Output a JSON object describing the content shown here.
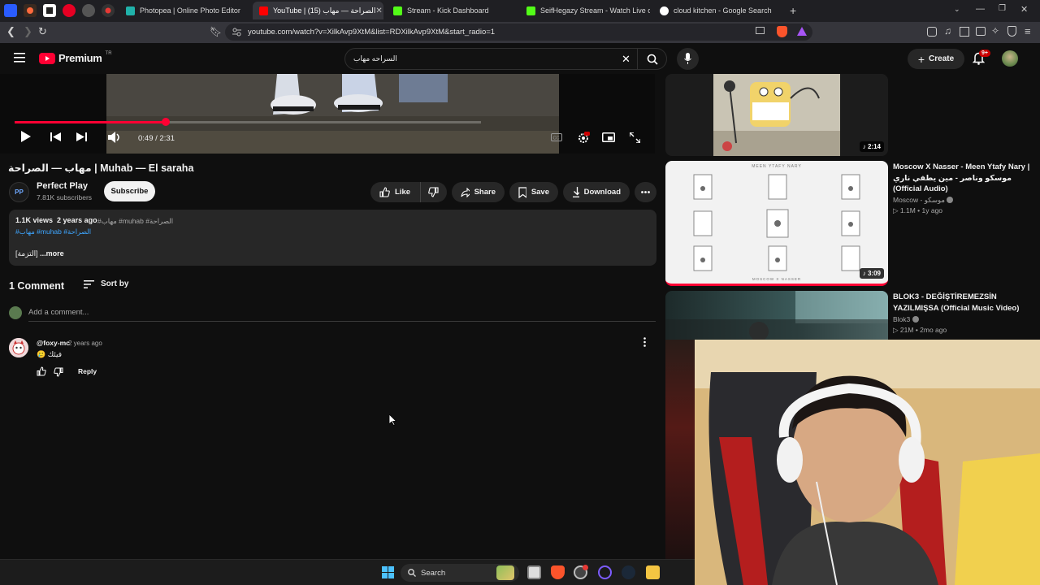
{
  "browser": {
    "tabs": [
      {
        "title": "Photopea | Online Photo Editor",
        "color": "#20b2aa"
      },
      {
        "title": "YouTube | الصراحة — مهاب (15)",
        "color": "#ff0000",
        "active": true
      },
      {
        "title": "Stream - Kick Dashboard",
        "color": "#53fc18"
      },
      {
        "title": "SeifHegazy Stream - Watch Live on K",
        "color": "#53fc18"
      },
      {
        "title": "cloud kitchen - Google Search",
        "color": "#ffffff"
      }
    ],
    "new_tab": "+",
    "url": "youtube.com/watch?v=XilkAvp9XtM&list=RDXilkAvp9XtM&start_radio=1"
  },
  "youtube": {
    "logo": "Premium",
    "logo_region": "TR",
    "search_query": "السراحه مهاب",
    "create_label": "Create",
    "notif_badge": "9+"
  },
  "player": {
    "time": "0:49 / 2:31",
    "progress_fraction": 0.324
  },
  "video": {
    "title": "مهاب — الصراحة | Muhab — El saraha",
    "channel": "Perfect Play",
    "channel_avatar": "PP",
    "subscribers": "7.81K subscribers",
    "subscribe_label": "Subscribe",
    "like_label": "Like",
    "share_label": "Share",
    "save_label": "Save",
    "download_label": "Download"
  },
  "description": {
    "views": "1.1K views",
    "age": "2 years ago",
    "tags_line1": "#مهاب #muhab #الصراحة",
    "tags_line2": "#مهاب #muhab #الصراحة",
    "snippet": "[التزمة]",
    "more_label": "...more"
  },
  "comments": {
    "count_label": "1 Comment",
    "sort_label": "Sort by",
    "add_placeholder": "Add a comment...",
    "items": [
      {
        "author": "@foxy-mc",
        "time": "2 years ago",
        "text": "🥲 فيئك",
        "reply_label": "Reply"
      }
    ]
  },
  "sidebar": {
    "items": [
      {
        "duration": "2:14"
      },
      {
        "title": "Moscow X Nasser - Meen Ytafy Nary | موسكو وناصر - مين يطفي ناري (Official Audio)",
        "channel": "Moscow - موسكو",
        "views": "1.1M",
        "age": "1y ago",
        "duration": "3:09",
        "thumb_caption": "MEEN YTAFY NARY",
        "thumb_footer": "MOSCOW X NASSER"
      },
      {
        "title": "BLOK3 - DEĞİŞTİREMEZSİN YAZILMIŞSA (Official Music Video)",
        "channel": "Blok3",
        "views": "21M",
        "age": "2mo ago"
      }
    ]
  },
  "taskbar": {
    "search_label": "Search"
  }
}
